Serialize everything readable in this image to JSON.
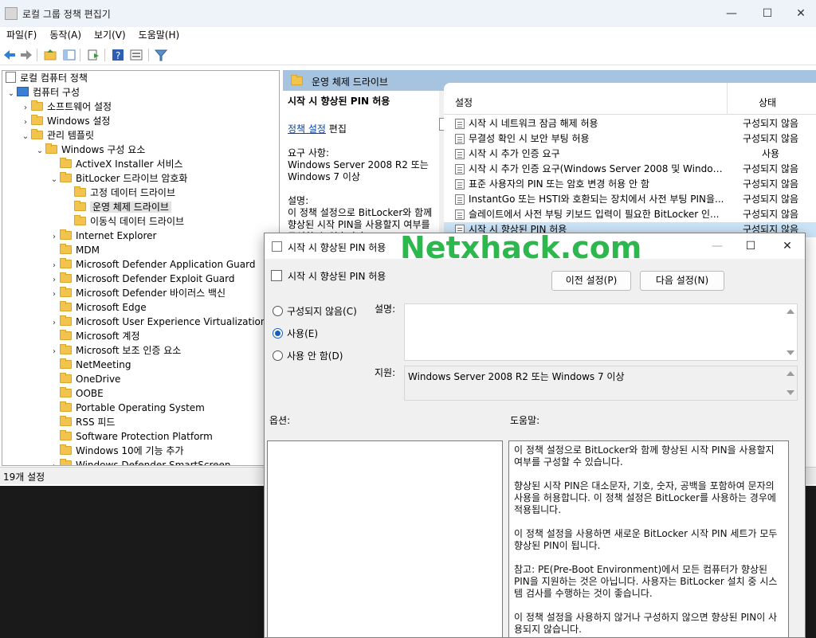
{
  "window": {
    "title": "로컬 그룹 정책 편집기",
    "min": "—",
    "max": "☐",
    "close": "✕"
  },
  "menu": [
    "파일(F)",
    "동작(A)",
    "보기(V)",
    "도움말(H)"
  ],
  "tree": {
    "root": "로컬 컴퓨터 정책",
    "computer": "컴퓨터 구성",
    "software": "소프트웨어 설정",
    "windows_settings": "Windows 설정",
    "admin_templates": "관리 템플릿",
    "windows_components": "Windows 구성 요소",
    "activex": "ActiveX Installer 서비스",
    "bitlocker": "BitLocker 드라이브 암호화",
    "fixed": "고정 데이터 드라이브",
    "os_drive": "운영 체제 드라이브",
    "removable": "이동식 데이터 드라이브",
    "items": [
      "Internet Explorer",
      "MDM",
      "Microsoft Defender Application Guard",
      "Microsoft Defender Exploit Guard",
      "Microsoft Defender 바이러스 백신",
      "Microsoft Edge",
      "Microsoft User Experience Virtualization",
      "Microsoft 계정",
      "Microsoft 보조 인증 요소",
      "NetMeeting",
      "OneDrive",
      "OOBE",
      "Portable Operating System",
      "RSS 피드",
      "Software Protection Platform",
      "Windows 10에 기능 추가",
      "Windows Defender SmartScreen"
    ],
    "expandable": [
      true,
      false,
      true,
      true,
      true,
      false,
      true,
      false,
      true,
      false,
      false,
      false,
      false,
      false,
      false,
      false,
      true
    ]
  },
  "status": "19개 설정",
  "right": {
    "header": "운영 체제 드라이브",
    "ext_title": "시작 시 향상된 PIN 허용",
    "ext_link": "정책 설정",
    "ext_edit": " 편집",
    "req_label": "요구 사항:",
    "req_text": "Windows Server 2008 R2 또는 Windows 7 이상",
    "desc_label": "설명:",
    "desc_text": "이 정책 설정으로 BitLocker와 함께 향상된 시작 PIN을 사용할지 여부를 구성할 수 있습니다"
  },
  "list": {
    "col_setting": "설정",
    "col_state": "상태",
    "rows": [
      {
        "name": "시작 시 네트워크 잠금 해제 허용",
        "state": "구성되지 않음"
      },
      {
        "name": "무결성 확인 시 보안 부팅 허용",
        "state": "구성되지 않음"
      },
      {
        "name": "시작 시 추가 인증 요구",
        "state": "사용"
      },
      {
        "name": "시작 시 추가 인증 요구(Windows Server 2008 및 Windows...",
        "state": "구성되지 않음"
      },
      {
        "name": "표준 사용자의 PIN 또는 암호 변경 허용 안 함",
        "state": "구성되지 않음"
      },
      {
        "name": "InstantGo 또는 HSTI와 호환되는 장치에서 사전 부팅 PIN을...",
        "state": "구성되지 않음"
      },
      {
        "name": "슬레이트에서 사전 부팅 키보드 입력이 필요한 BitLocker 인...",
        "state": "구성되지 않음"
      },
      {
        "name": "시작 시 향상된 PIN 허용",
        "state": "구성되지 않음"
      }
    ]
  },
  "dialog": {
    "title": "시작 시 향상된 PIN 허용",
    "watermark": "Netxhack.com",
    "subtitle": "시작 시 향상된 PIN 허용",
    "prev": "이전 설정(P)",
    "next": "다음 설정(N)",
    "radio_not_configured": "구성되지 않음(C)",
    "radio_enabled": "사용(E)",
    "radio_disabled": "사용 안 함(D)",
    "comment_label": "설명:",
    "support_label": "지원:",
    "support_text": "Windows Server 2008 R2 또는 Windows 7 이상",
    "options_label": "옵션:",
    "help_label": "도움말:",
    "help": [
      "이 정책 설정으로 BitLocker와 함께 향상된 시작 PIN을 사용할지 여부를 구성할 수 있습니다.",
      "향상된 시작 PIN은 대소문자, 기호, 숫자, 공백을 포함하여 문자의 사용을 허용합니다. 이 정책 설정은 BitLocker를 사용하는 경우에 적용됩니다.",
      "이 정책 설정을 사용하면 새로운 BitLocker 시작 PIN 세트가 모두 향상된 PIN이 됩니다.",
      "참고: PE(Pre-Boot Environment)에서 모든 컴퓨터가 향상된 PIN을 지원하는 것은 아닙니다. 사용자는 BitLocker 설치 중 시스템 검사를 수행하는 것이 좋습니다.",
      "이 정책 설정을 사용하지 않거나 구성하지 않으면 향상된 PIN이 사용되지 않습니다."
    ]
  }
}
